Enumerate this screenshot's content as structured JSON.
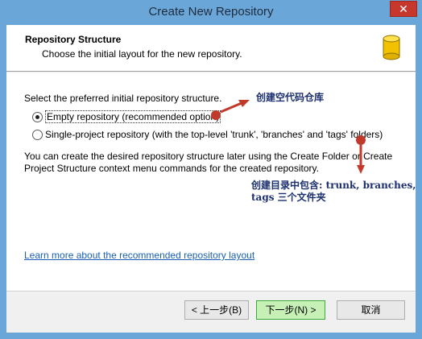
{
  "window": {
    "title": "Create New Repository",
    "close_label": "✕"
  },
  "header": {
    "title": "Repository Structure",
    "subtitle": "Choose the initial layout for the new repository."
  },
  "body": {
    "intro": "Select the preferred initial repository structure.",
    "options": [
      {
        "label": "Empty repository (recommended option)",
        "selected": true
      },
      {
        "label": "Single-project repository (with the top-level 'trunk', 'branches' and 'tags' folders)",
        "selected": false
      }
    ],
    "note": "You can create the desired repository structure later using the Create Folder or Create Project Structure context menu commands for the created repository.",
    "learn_link": "Learn more about the recommended repository layout"
  },
  "buttons": {
    "back": "< 上一步(B)",
    "next": "下一步(N) >",
    "cancel": "取消"
  },
  "annotations": {
    "empty_note": "创建空代码仓库",
    "folders_note_line1": "创建目录中包含: trunk, branches,",
    "folders_note_line2": "tags 三个文件夹",
    "color": "#c0392b"
  }
}
